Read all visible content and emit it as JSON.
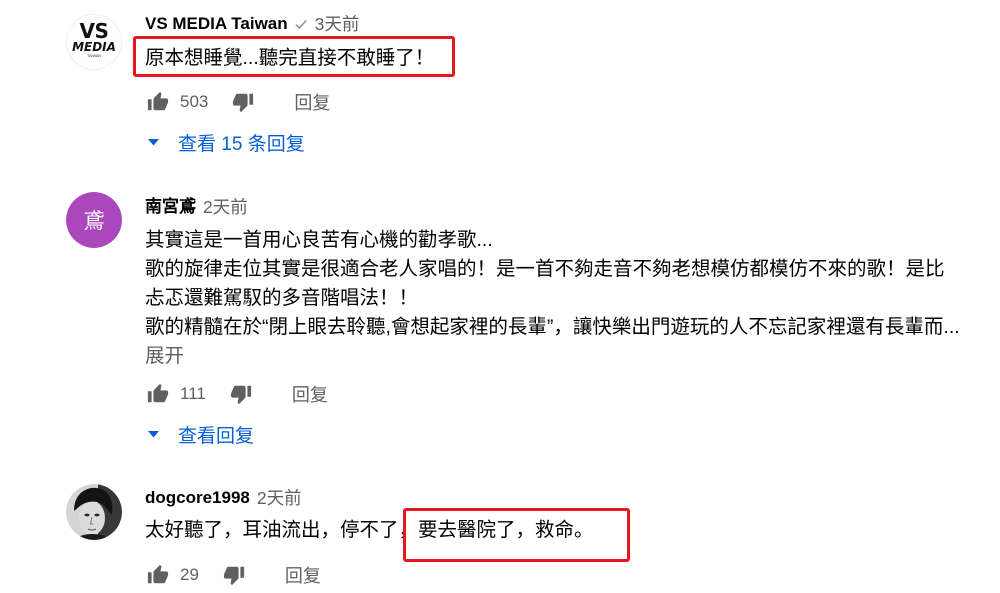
{
  "colors": {
    "text": "#030303",
    "secondary": "#606060",
    "link": "#065fd4",
    "icon": "#606060",
    "verified_check": "#909090",
    "highlight_box": "#e5161f",
    "background": "#ffffff"
  },
  "icons": {
    "like": "thumbs-up-icon",
    "dislike": "thumbs-down-icon",
    "expand_replies": "caret-down-icon",
    "verified": "verified-check-icon"
  },
  "comments": [
    {
      "author": "VS MEDIA Taiwan",
      "verified": true,
      "time": "3天前",
      "avatar": {
        "logo_text": [
          "VS",
          "MEDIA",
          "TAIWAN"
        ]
      },
      "text": [
        "原本想睡覺...聽完直接不敢睡了！"
      ],
      "highlighted": true,
      "likes": "503",
      "reply_label": "回复",
      "view_replies_label": "查看 15 条回复"
    },
    {
      "author": "南宮鳶",
      "verified": false,
      "time": "2天前",
      "avatar": {
        "initial": "鳶",
        "color": "#ab47bc"
      },
      "text": [
        "其實這是一首用心良苦有心機的勸孝歌...",
        "歌的旋律走位其實是很適合老人家唱的！是一首不夠走音不夠老想模仿都模仿不來的歌！是比",
        "忐忑還難駕馭的多音階唱法！！",
        "歌的精髓在於“閉上眼去聆聽,會想起家裡的長輩”，讓快樂出門遊玩的人不忘記家裡還有長輩而..."
      ],
      "read_more_label": "展开",
      "highlighted": false,
      "likes": "111",
      "reply_label": "回复",
      "view_replies_label": "查看回复"
    },
    {
      "author": "dogcore1998",
      "verified": false,
      "time": "2天前",
      "text": [
        "太好聽了，耳油流出，停不了，要去醫院了，救命。"
      ],
      "highlighted": true,
      "likes": "29",
      "reply_label": "回复"
    }
  ]
}
